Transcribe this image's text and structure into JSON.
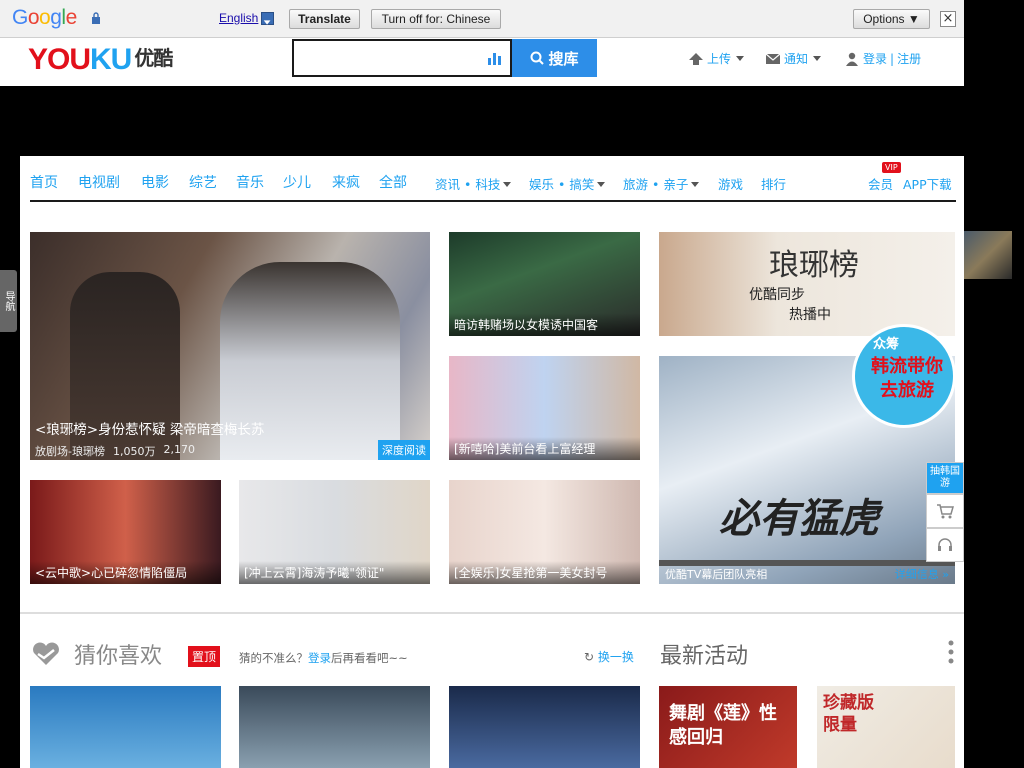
{
  "google_bar": {
    "logo": "Google",
    "language": "English",
    "translate_label": "Translate",
    "turnoff_label": "Turn off for: Chinese",
    "options_label": "Options ▼",
    "close_label": "×"
  },
  "header": {
    "logo_you": "YOU",
    "logo_ku": "KU",
    "logo_cn": "优酷",
    "search_value": "",
    "search_button": "搜库",
    "upload": "上传",
    "notify": "通知",
    "login": "登录",
    "sep": "|",
    "register": "注册"
  },
  "nav": {
    "items": [
      "首页",
      "电视剧",
      "电影",
      "综艺",
      "音乐",
      "少儿",
      "来疯",
      "全部"
    ],
    "small_items": [
      "资讯 • 科技",
      "娱乐 • 搞笑",
      "旅游 • 亲子",
      "游戏",
      "排行"
    ],
    "vip_badge": "VIP",
    "member": "会员",
    "app": "APP下载"
  },
  "side_nav": "导航",
  "tiles": {
    "hero_caption": "<琅琊榜>身份惹怀疑 梁帝暗查梅长苏",
    "hero_meta_source": "放剧场-琅琊榜",
    "hero_views": "1,050万",
    "hero_comments": "2,170",
    "hero_tag": "深度阅读",
    "t1": "暗访韩赌场以女模诱中国客",
    "t2": "[新嘻哈]美前台看上富经理",
    "t3": "<云中歌>心已碎忽情陷僵局",
    "t4": "[冲上云霄]海涛予曦\"领证\"",
    "t5": "[全娱乐]女星抢第一美女封号",
    "ad_title": "琅琊榜",
    "ad_sub": "优酷同步",
    "ad_hot": "热播中",
    "big_caption": "优酷TV幕后团队亮相",
    "big_more": "详细信息 »",
    "big_title": "必有猛虎",
    "crowd_label": "众筹",
    "crowd_text": "韩流带你去旅游",
    "float_1": "抽韩国游"
  },
  "guess": {
    "title": "猜你喜欢",
    "tag": "置顶",
    "sub_pre": "猜的不准么？",
    "sub_link": "登录",
    "sub_post": "后再看看吧~~",
    "swap": "换一换"
  },
  "activity": {
    "title": "最新活动",
    "b1": "舞剧《莲》性感回归",
    "b2": "珍藏版限量"
  }
}
